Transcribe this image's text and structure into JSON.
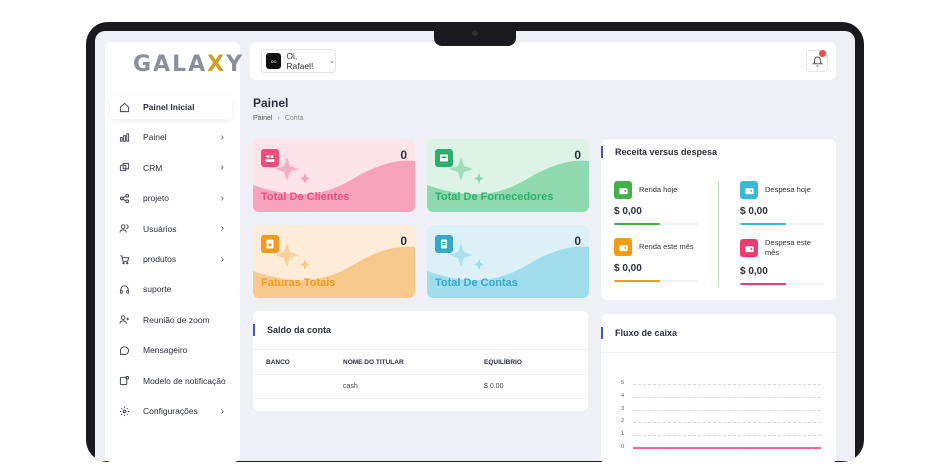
{
  "brand": {
    "logo_pre": "GALA",
    "logo_x": "X",
    "logo_post": "Y"
  },
  "sidebar": {
    "items": [
      {
        "label": "Painel Inicial",
        "icon": "home-icon",
        "chevron": false,
        "active": true
      },
      {
        "label": "Painel",
        "icon": "chart-icon",
        "chevron": true
      },
      {
        "label": "CRM",
        "icon": "layers-icon",
        "chevron": true
      },
      {
        "label": "projeto",
        "icon": "share-icon",
        "chevron": true
      },
      {
        "label": "Usuários",
        "icon": "users-icon",
        "chevron": true
      },
      {
        "label": "produtos",
        "icon": "cart-icon",
        "chevron": true
      },
      {
        "label": "suporte",
        "icon": "headset-icon",
        "chevron": false
      },
      {
        "label": "Reunião de zoom",
        "icon": "user-plus-icon",
        "chevron": false
      },
      {
        "label": "Mensageiro",
        "icon": "chat-icon",
        "chevron": false
      },
      {
        "label": "Modelo de notificação",
        "icon": "notification-icon",
        "chevron": false
      },
      {
        "label": "Configurações",
        "icon": "gear-icon",
        "chevron": true
      }
    ]
  },
  "topbar": {
    "greeting": "Oi, Rafael!",
    "avatar_text": "DG",
    "notifications": "bell-icon"
  },
  "header": {
    "title": "Painel",
    "breadcrumb": [
      "Painel",
      "Conta"
    ]
  },
  "stats": [
    {
      "label": "Total De Clientes",
      "value": "0",
      "color": "#ec4f7d",
      "bg": "#fde4ea",
      "wave": "#f6a3bb"
    },
    {
      "label": "Total De Fornecedores",
      "value": "0",
      "color": "#2fae6b",
      "bg": "#dcf3e6",
      "wave": "#8fd9b0"
    },
    {
      "label": "Faturas Totais",
      "value": "0",
      "color": "#f19a1e",
      "bg": "#fdecd7",
      "wave": "#f7c98a"
    },
    {
      "label": "Total De Contas",
      "value": "0",
      "color": "#3aa7c4",
      "bg": "#dcf1f7",
      "wave": "#9fdcec"
    }
  ],
  "revenue_expense": {
    "title": "Receita versus despesa",
    "items": [
      {
        "label": "Renda hoje",
        "value": "$ 0,00",
        "color": "#43b04a",
        "fill": 0.55
      },
      {
        "label": "Despesa hoje",
        "value": "$ 0,00",
        "color": "#3ab8d6",
        "fill": 0.55
      },
      {
        "label": "Renda este mês",
        "value": "$ 0,00",
        "color": "#f39c12",
        "fill": 0.55
      },
      {
        "label": "Despesa este mês",
        "value": "$ 0,00",
        "color": "#ea3c6e",
        "fill": 0.55
      }
    ]
  },
  "account_balance": {
    "title": "Saldo da conta",
    "columns": [
      "BANCO",
      "NOME DO TITULAR",
      "EQUILÍBRIO"
    ],
    "rows": [
      [
        "",
        "cash",
        "$ 0.00"
      ]
    ]
  },
  "cash_flow": {
    "title": "Fluxo de caixa",
    "chart_data": {
      "type": "line",
      "title": "",
      "xlabel": "",
      "ylabel": "",
      "y_ticks": [
        "5",
        "4",
        "3",
        "2",
        "1",
        "0"
      ],
      "ylim": [
        0,
        5
      ],
      "grid": true,
      "series": [
        {
          "values": [
            0,
            0,
            0,
            0,
            0,
            0,
            0
          ]
        }
      ]
    }
  }
}
